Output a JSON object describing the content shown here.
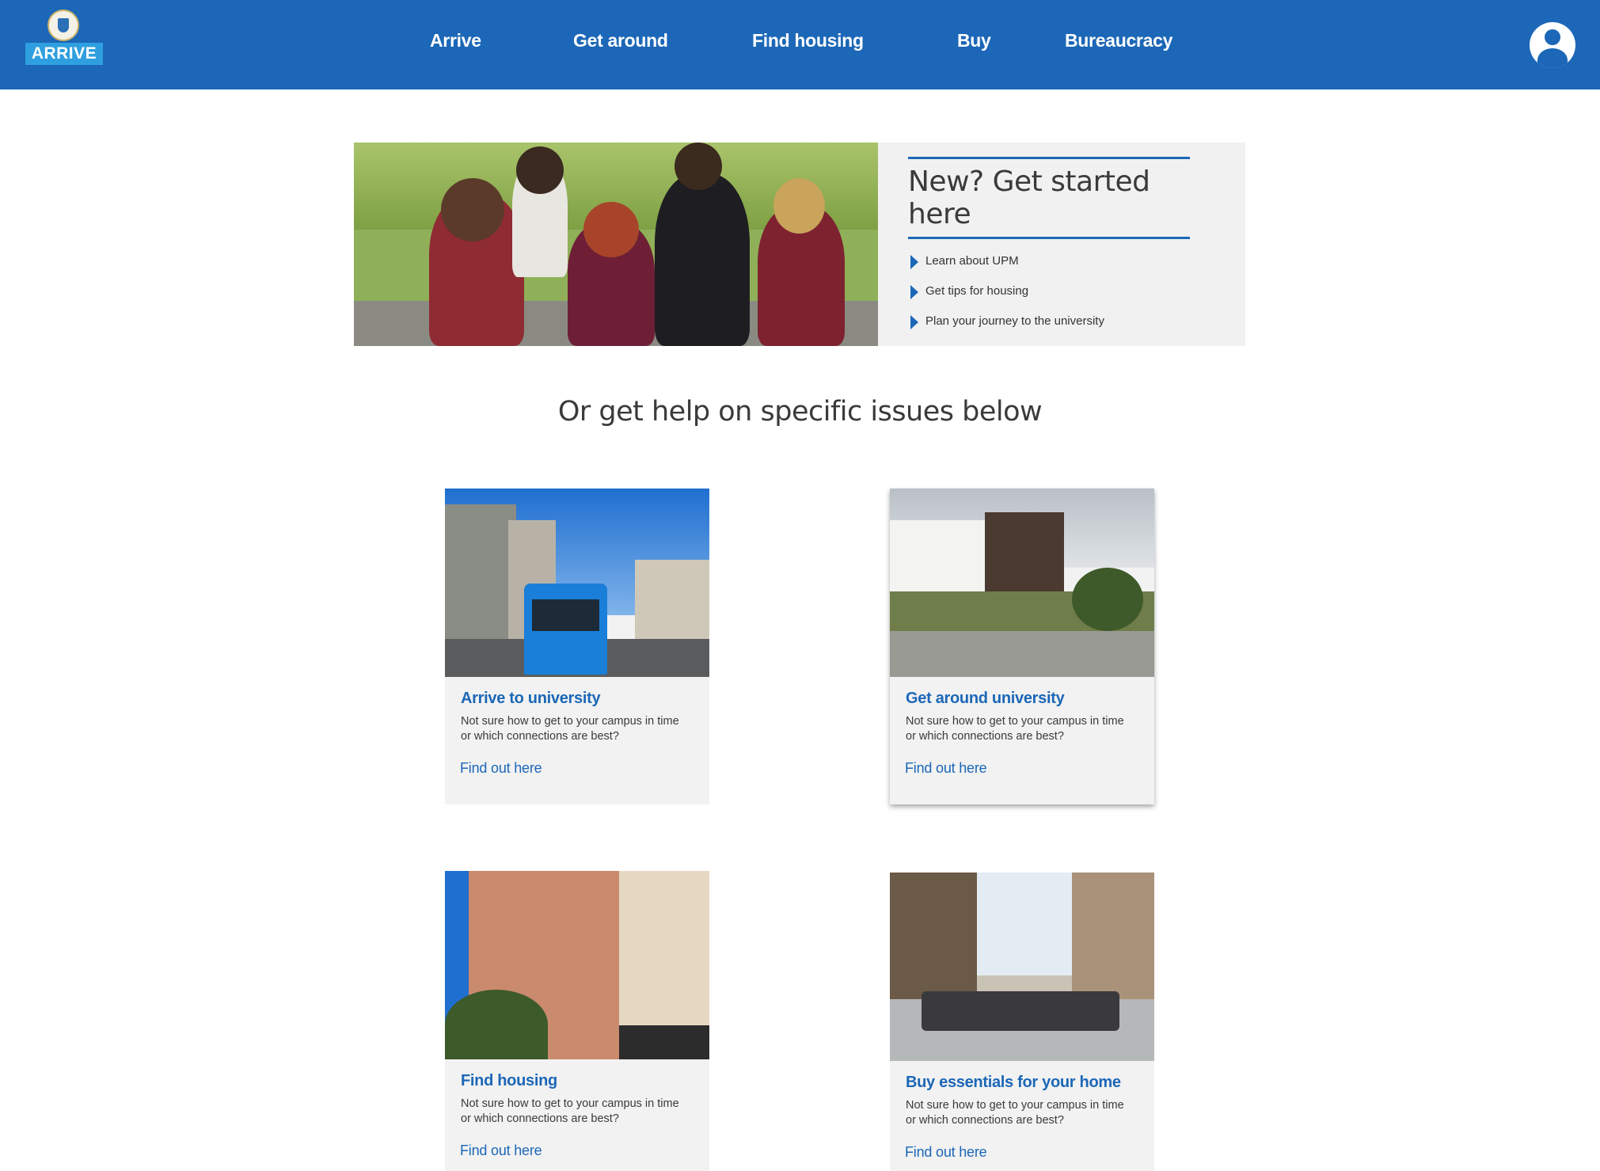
{
  "header": {
    "logo_text": "ARRIVE",
    "nav": [
      "Arrive",
      "Get around",
      "Find housing",
      "Buy",
      "Bureaucracy"
    ]
  },
  "hero": {
    "title": "New? Get started here",
    "items": [
      "Learn about UPM",
      "Get tips for housing",
      "Plan your journey to the university"
    ]
  },
  "section": {
    "heading": "Or get help on specific issues below"
  },
  "cards": [
    {
      "title": "Arrive to university",
      "desc": "Not sure how to get to your campus in time or which connections are best?",
      "link": "Find out here"
    },
    {
      "title": "Get around university",
      "desc": "Not sure how to get to your campus in time or which connections are best?",
      "link": "Find out here"
    },
    {
      "title": "Find housing",
      "desc": "Not sure how to get to your campus in time or which connections are best?",
      "link": "Find out here"
    },
    {
      "title": "Buy essentials for your home",
      "desc": "Not sure how to get to your campus in time or which connections are best?",
      "link": "Find out here"
    }
  ],
  "colors": {
    "brand": "#1c67b7",
    "logo_bg": "#2f9fe0",
    "panel_bg": "#f1f1f1"
  }
}
